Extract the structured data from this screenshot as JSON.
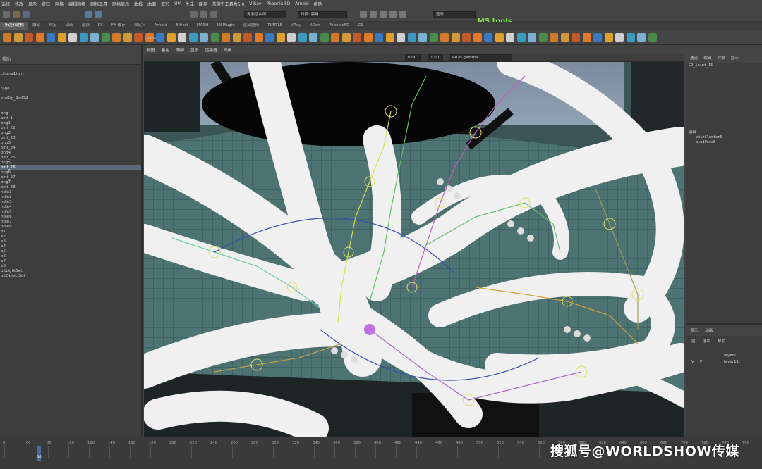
{
  "menu": [
    "选择",
    "修改",
    "显示",
    "窗口",
    "网格",
    "编辑网格",
    "网格工具",
    "网格显示",
    "曲线",
    "曲面",
    "变形",
    "UV",
    "生成",
    "缓存",
    "茶楼牛工具盒5.0",
    "V-Ray",
    "Phoenix FD",
    "Arnold",
    "帮助"
  ],
  "status": {
    "input_placeholder": "无激活曲面",
    "symmetry": "对称: 禁用",
    "login": "登录",
    "mstools": "MS tools"
  },
  "shelf_tabs": [
    "多边形建模",
    "雕刻",
    "绑定",
    "动画",
    "渲染",
    "FX",
    "FX 缓存",
    "自定义",
    "Arnold",
    "Bifrost",
    "MASH",
    "MSPlugin",
    "运动图形",
    "TURTLE",
    "VRay",
    "XGen",
    "PhoenixFD",
    "GS"
  ],
  "shelf_value": "0.0.0",
  "outliner": {
    "header": "帮助",
    "items": [
      "ctionalLight",
      "",
      "",
      "tage",
      "",
      "eraRig_Rail14",
      "",
      "",
      "ong",
      "oint_1",
      "ong1",
      "oint_22",
      "ong2",
      "oint_23",
      "ong3",
      "oint_24",
      "ong4",
      "oint_25",
      "ong5",
      "oint_26",
      "ong6",
      "oint_27",
      "ong7",
      "oint_28",
      "ndle1",
      "ndle2",
      "ndle3",
      "ndle4",
      "ndle5",
      "ndle6",
      "ndle7",
      "ndle8",
      "e1",
      "e2",
      "e3",
      "e4",
      "e5",
      "e6",
      "e7",
      "e8",
      "ultLightSet",
      "ultObjectSet"
    ],
    "selected_index": 19
  },
  "viewport": {
    "menu": [
      "视图",
      "着色",
      "照明",
      "显示",
      "渲染器",
      "面板"
    ],
    "field_a": "0.00",
    "field_b": "1.00",
    "colorspace": "sRGB gamma"
  },
  "channelbox": {
    "tabs": [
      "通道",
      "编辑",
      "对象",
      "显示"
    ],
    "object": "CJ_joint_15",
    "outputs_label": "输出",
    "outputs": [
      "skinCluster6",
      "bindPose6"
    ]
  },
  "layers": {
    "tabs": [
      "显示",
      "动画"
    ],
    "menu": [
      "层",
      "选项",
      "帮助"
    ],
    "rows": [
      {
        "v": "",
        "p": "",
        "name": "layer1"
      },
      {
        "v": "V",
        "p": "P",
        "name": "layer11"
      }
    ]
  },
  "timeline": {
    "ticks": [
      "0",
      "60",
      "80",
      "100",
      "120",
      "140",
      "160",
      "180",
      "200",
      "220",
      "240",
      "260",
      "280",
      "300",
      "320",
      "340",
      "360",
      "380",
      "400",
      "420",
      "440",
      "460",
      "480",
      "500",
      "520",
      "540",
      "560",
      "580",
      "600",
      "620",
      "640",
      "660",
      "680",
      "700",
      "720",
      "740",
      "760",
      "780"
    ],
    "current_frame": "91"
  },
  "watermark": "搜狐号@WORLDSHOW传媒"
}
